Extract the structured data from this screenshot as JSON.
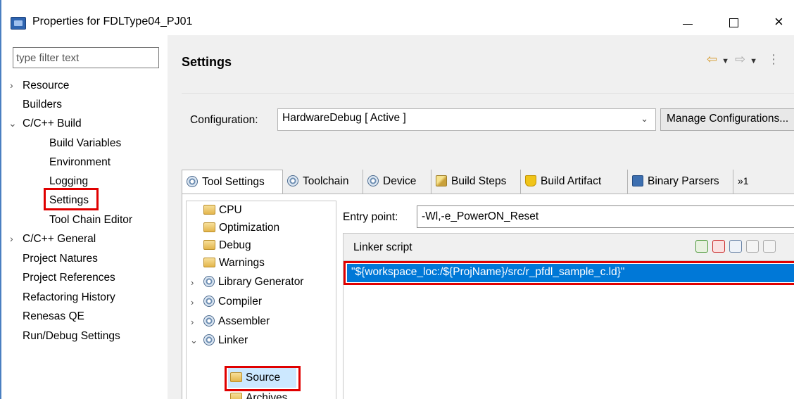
{
  "window": {
    "title": "Properties for FDLType04_PJ01",
    "controls": {
      "minimize": "minimize",
      "maximize": "maximize",
      "close": "×"
    }
  },
  "left_pane": {
    "filter_placeholder": "type filter text",
    "tree": [
      {
        "label": "Resource",
        "expander": "›"
      },
      {
        "label": "Builders"
      },
      {
        "label": "C/C++ Build",
        "expander": "⌄"
      },
      {
        "label": "Build Variables"
      },
      {
        "label": "Environment"
      },
      {
        "label": "Logging"
      },
      {
        "label": "Settings",
        "selected": true
      },
      {
        "label": "Tool Chain Editor"
      },
      {
        "label": "C/C++ General",
        "expander": "›"
      },
      {
        "label": "Project Natures"
      },
      {
        "label": "Project References"
      },
      {
        "label": "Refactoring History"
      },
      {
        "label": "Renesas QE"
      },
      {
        "label": "Run/Debug Settings"
      }
    ]
  },
  "header": {
    "title": "Settings",
    "nav": {
      "back": "⇦",
      "forward": "⇨",
      "dropdown": "▼",
      "menu": "⋮"
    }
  },
  "configuration": {
    "label": "Configuration:",
    "value": "HardwareDebug  [ Active ]",
    "dropdown_arrow": "⌄",
    "manage_button": "Manage Configurations..."
  },
  "tabs": [
    {
      "label": "Tool Settings",
      "icon": "gear-icon",
      "active": true
    },
    {
      "label": "Toolchain",
      "icon": "gear-icon"
    },
    {
      "label": "Device",
      "icon": "gear-icon"
    },
    {
      "label": "Build Steps",
      "icon": "build-steps-icon"
    },
    {
      "label": "Build Artifact",
      "icon": "trophy-icon"
    },
    {
      "label": "Binary Parsers",
      "icon": "binary-icon"
    },
    {
      "label": "»1",
      "icon": ""
    }
  ],
  "tool_tree": [
    {
      "label": "CPU"
    },
    {
      "label": "Optimization"
    },
    {
      "label": "Debug"
    },
    {
      "label": "Warnings"
    },
    {
      "label": "Library Generator",
      "expander": "›"
    },
    {
      "label": "Compiler",
      "expander": "›"
    },
    {
      "label": "Assembler",
      "expander": "›"
    },
    {
      "label": "Linker",
      "expander": "⌄"
    },
    {
      "label": "Source",
      "selected": true
    },
    {
      "label": "Archives"
    }
  ],
  "form": {
    "entry_point_label": "Entry point:",
    "entry_point_value": "-Wl,-e_PowerON_Reset",
    "linker_script_label": "Linker script",
    "linker_script_items": [
      "\"${workspace_loc:/${ProjName}/src/r_pfdl_sample_c.ld}\""
    ]
  }
}
